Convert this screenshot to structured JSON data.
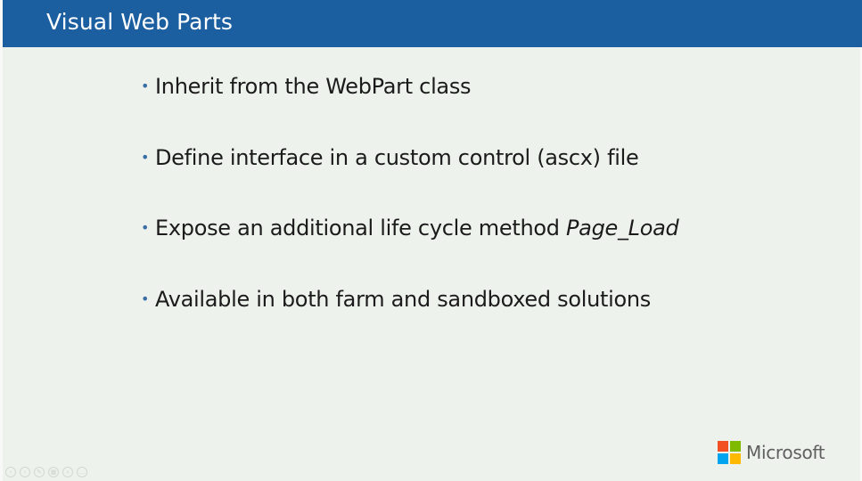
{
  "slide": {
    "title": "Visual Web Parts",
    "bullets": [
      {
        "marker": "•",
        "text": "Inherit from the WebPart class",
        "emphasis": ""
      },
      {
        "marker": "•",
        "text": "Define interface in a custom control (ascx) file",
        "emphasis": ""
      },
      {
        "marker": "•",
        "text": "Expose an additional life cycle method ",
        "emphasis": "Page_Load"
      },
      {
        "marker": "•",
        "text": "Available in both farm and sandboxed solutions",
        "emphasis": ""
      }
    ]
  },
  "logo": {
    "text": "Microsoft",
    "colors": [
      "#f25022",
      "#7fba00",
      "#00a4ef",
      "#ffb900"
    ]
  },
  "controls": [
    {
      "icon": "previous-icon",
      "glyph": "‹"
    },
    {
      "icon": "next-icon",
      "glyph": "›"
    },
    {
      "icon": "pen-icon",
      "glyph": "✎"
    },
    {
      "icon": "slides-icon",
      "glyph": "▦"
    },
    {
      "icon": "zoom-icon",
      "glyph": "⌕"
    },
    {
      "icon": "more-icon",
      "glyph": "…"
    }
  ],
  "colors": {
    "title_bar": "#1c5fa0",
    "background": "#eef2ed",
    "bullet": "#3b6ea5",
    "text": "#1b1b1b"
  }
}
